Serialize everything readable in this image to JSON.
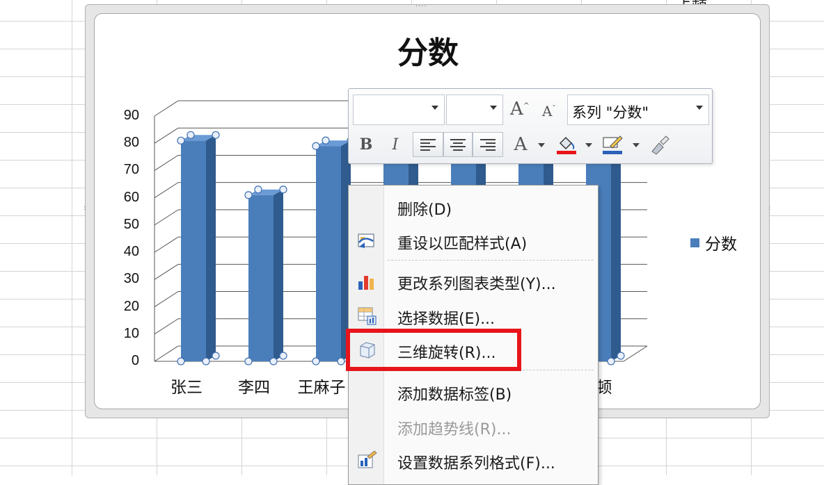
{
  "sheet": {
    "partial_header_text": "卡顿"
  },
  "chart_data": {
    "type": "bar",
    "title": "分数",
    "categories": [
      "张三",
      "李四",
      "王麻子",
      "",
      "",
      "",
      "顿"
    ],
    "series": [
      {
        "name": "分数",
        "values": [
          81,
          61,
          79,
          82,
          82,
          82,
          82
        ]
      }
    ],
    "yticks": [
      "90",
      "80",
      "70",
      "60",
      "50",
      "40",
      "30",
      "20",
      "10",
      "0"
    ],
    "ylim": [
      0,
      90
    ],
    "grid": true,
    "legend": "right",
    "colors": {
      "bar_front": "#4a7ebb",
      "bar_side": "#2f5b8e",
      "bar_top": "#6b9bd6"
    }
  },
  "mini_toolbar": {
    "font_name": "",
    "font_size": "",
    "grow_font": "A",
    "shrink_font": "A",
    "element_selector": "系列 \"分数\"",
    "bold": "B",
    "italic": "I",
    "font_color": "A",
    "icons": [
      "align-left-icon",
      "align-center-icon",
      "align-right-icon",
      "fill-bucket-icon",
      "pen-outline-icon",
      "format-painter-icon"
    ],
    "fill_color": "#e8141b",
    "outline_color": "#2b62b8"
  },
  "context_menu": {
    "items": [
      {
        "label": "删除(D)",
        "icon": "",
        "disabled": false
      },
      {
        "label": "重设以匹配样式(A)",
        "icon": "reset-style-icon",
        "disabled": false
      },
      {
        "label": "更改系列图表类型(Y)...",
        "icon": "chart-type-icon",
        "disabled": false
      },
      {
        "label": "选择数据(E)...",
        "icon": "select-data-icon",
        "disabled": false
      },
      {
        "label": "三维旋转(R)...",
        "icon": "cube-3d-icon",
        "disabled": false
      },
      {
        "label": "添加数据标签(B)",
        "icon": "",
        "disabled": false
      },
      {
        "label": "添加趋势线(R)...",
        "icon": "",
        "disabled": true
      },
      {
        "label": "设置数据系列格式(F)...",
        "icon": "format-series-icon",
        "disabled": false
      }
    ],
    "highlight_color": "#e8141b"
  }
}
